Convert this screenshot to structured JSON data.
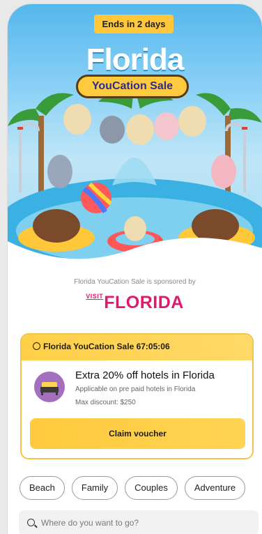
{
  "hero": {
    "badge": "Ends in 2 days",
    "title": "Florida",
    "subtitle": "YouCation Sale"
  },
  "sponsor": {
    "text": "Florida YouCation Sale is sponsored by",
    "logo_small": "VISIT",
    "logo_main": "FLORIDA"
  },
  "voucher": {
    "header": "Florida YouCation Sale 67:05:06",
    "title": "Extra 20% off hotels in Florida",
    "subtitle": "Applicable on pre paid hotels in Florida",
    "max": "Max discount: $250",
    "button": "Claim voucher"
  },
  "chips": [
    "Beach",
    "Family",
    "Couples",
    "Adventure"
  ],
  "search": {
    "placeholder": "Where do you want to go?"
  },
  "colors": {
    "accent": "#ffca3e",
    "brand": "#e2186f",
    "sky": "#55b7ec",
    "icon_bg": "#a46fbf"
  }
}
